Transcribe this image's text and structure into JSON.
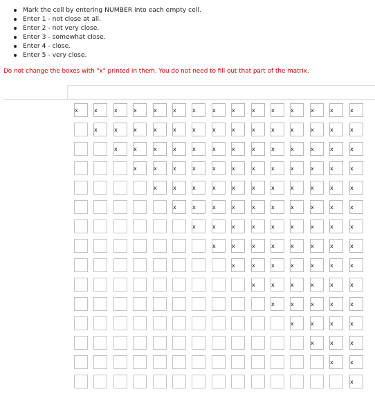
{
  "instructions": [
    "Mark the cell by entering NUMBER into each empty cell.",
    "Enter 1 - not close at all.",
    "Enter 2 - not very close.",
    "Enter 3 - somewhat close.",
    "Enter 4 - close.",
    "Enter 5 - very close."
  ],
  "warning": "Do not change the boxes with \"x\" printed in them. You do not need to fill out that part of the matrix.",
  "matrix": {
    "rows": 15,
    "cols": 15,
    "filled_marker": "x"
  }
}
